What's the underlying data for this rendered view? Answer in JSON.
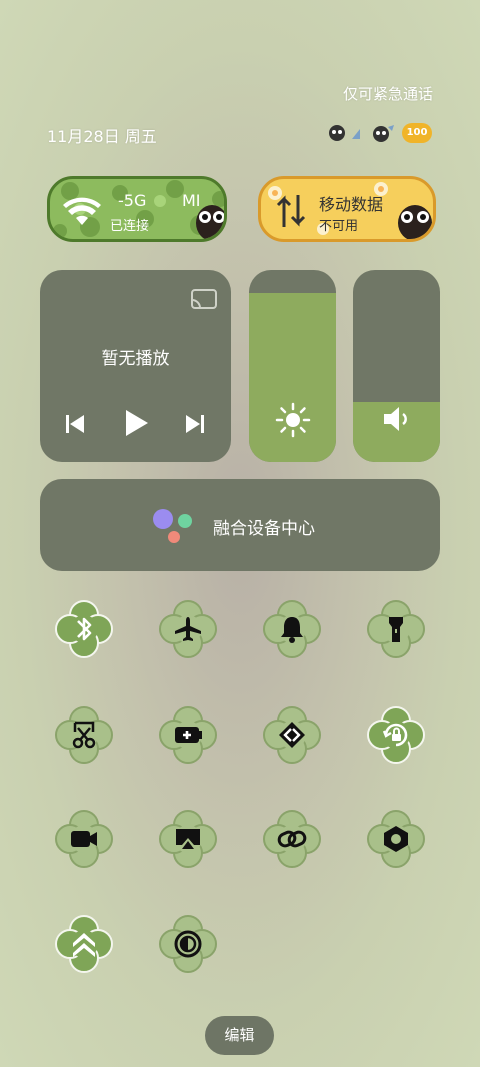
{
  "status_bar": {
    "emergency_text": "仅可紧急通话",
    "date_text": "11月28日 周五",
    "battery_text": "100"
  },
  "quick_pills": {
    "wifi": {
      "title": "-5G",
      "ssid_fragment": "MI",
      "subtitle": "已连接"
    },
    "mobile_data": {
      "title": "移动数据",
      "subtitle": "不可用"
    }
  },
  "media": {
    "status": "暂无播放"
  },
  "sliders": {
    "brightness_level": 0.88,
    "volume_level": 0.31
  },
  "device_center": {
    "label": "融合设备中心"
  },
  "toggles": [
    {
      "name": "bluetooth-icon",
      "active": true
    },
    {
      "name": "airplane-icon",
      "active": false
    },
    {
      "name": "bell-icon",
      "active": false
    },
    {
      "name": "flashlight-icon",
      "active": false
    },
    {
      "name": "screenshot-icon",
      "active": false
    },
    {
      "name": "battery-saver-icon",
      "active": false
    },
    {
      "name": "nearby-share-icon",
      "active": false
    },
    {
      "name": "rotation-lock-icon",
      "active": true
    },
    {
      "name": "video-camera-icon",
      "active": false
    },
    {
      "name": "screen-cast-icon",
      "active": false
    },
    {
      "name": "link-icon",
      "active": false
    },
    {
      "name": "settings-hex-icon",
      "active": false
    },
    {
      "name": "double-chevron-up-icon",
      "active": true
    },
    {
      "name": "contrast-icon",
      "active": false
    }
  ],
  "edit_button": {
    "label": "编辑"
  },
  "colors": {
    "accent_green": "#8eab5e",
    "tile_gray": "#707766",
    "clover_inactive": "#a9c08a",
    "clover_active": "#7fa557"
  }
}
